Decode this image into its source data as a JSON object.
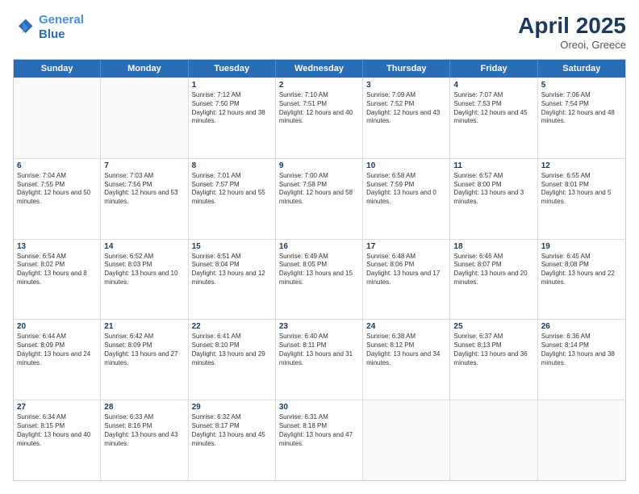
{
  "header": {
    "logo_line1": "General",
    "logo_line2": "Blue",
    "month_title": "April 2025",
    "location": "Oreoi, Greece"
  },
  "days_of_week": [
    "Sunday",
    "Monday",
    "Tuesday",
    "Wednesday",
    "Thursday",
    "Friday",
    "Saturday"
  ],
  "weeks": [
    [
      {
        "day": "",
        "empty": true
      },
      {
        "day": "",
        "empty": true
      },
      {
        "day": "1",
        "sunrise": "Sunrise: 7:12 AM",
        "sunset": "Sunset: 7:50 PM",
        "daylight": "Daylight: 12 hours and 38 minutes."
      },
      {
        "day": "2",
        "sunrise": "Sunrise: 7:10 AM",
        "sunset": "Sunset: 7:51 PM",
        "daylight": "Daylight: 12 hours and 40 minutes."
      },
      {
        "day": "3",
        "sunrise": "Sunrise: 7:09 AM",
        "sunset": "Sunset: 7:52 PM",
        "daylight": "Daylight: 12 hours and 43 minutes."
      },
      {
        "day": "4",
        "sunrise": "Sunrise: 7:07 AM",
        "sunset": "Sunset: 7:53 PM",
        "daylight": "Daylight: 12 hours and 45 minutes."
      },
      {
        "day": "5",
        "sunrise": "Sunrise: 7:06 AM",
        "sunset": "Sunset: 7:54 PM",
        "daylight": "Daylight: 12 hours and 48 minutes."
      }
    ],
    [
      {
        "day": "6",
        "sunrise": "Sunrise: 7:04 AM",
        "sunset": "Sunset: 7:55 PM",
        "daylight": "Daylight: 12 hours and 50 minutes."
      },
      {
        "day": "7",
        "sunrise": "Sunrise: 7:03 AM",
        "sunset": "Sunset: 7:56 PM",
        "daylight": "Daylight: 12 hours and 53 minutes."
      },
      {
        "day": "8",
        "sunrise": "Sunrise: 7:01 AM",
        "sunset": "Sunset: 7:57 PM",
        "daylight": "Daylight: 12 hours and 55 minutes."
      },
      {
        "day": "9",
        "sunrise": "Sunrise: 7:00 AM",
        "sunset": "Sunset: 7:58 PM",
        "daylight": "Daylight: 12 hours and 58 minutes."
      },
      {
        "day": "10",
        "sunrise": "Sunrise: 6:58 AM",
        "sunset": "Sunset: 7:59 PM",
        "daylight": "Daylight: 13 hours and 0 minutes."
      },
      {
        "day": "11",
        "sunrise": "Sunrise: 6:57 AM",
        "sunset": "Sunset: 8:00 PM",
        "daylight": "Daylight: 13 hours and 3 minutes."
      },
      {
        "day": "12",
        "sunrise": "Sunrise: 6:55 AM",
        "sunset": "Sunset: 8:01 PM",
        "daylight": "Daylight: 13 hours and 5 minutes."
      }
    ],
    [
      {
        "day": "13",
        "sunrise": "Sunrise: 6:54 AM",
        "sunset": "Sunset: 8:02 PM",
        "daylight": "Daylight: 13 hours and 8 minutes."
      },
      {
        "day": "14",
        "sunrise": "Sunrise: 6:52 AM",
        "sunset": "Sunset: 8:03 PM",
        "daylight": "Daylight: 13 hours and 10 minutes."
      },
      {
        "day": "15",
        "sunrise": "Sunrise: 6:51 AM",
        "sunset": "Sunset: 8:04 PM",
        "daylight": "Daylight: 13 hours and 12 minutes."
      },
      {
        "day": "16",
        "sunrise": "Sunrise: 6:49 AM",
        "sunset": "Sunset: 8:05 PM",
        "daylight": "Daylight: 13 hours and 15 minutes."
      },
      {
        "day": "17",
        "sunrise": "Sunrise: 6:48 AM",
        "sunset": "Sunset: 8:06 PM",
        "daylight": "Daylight: 13 hours and 17 minutes."
      },
      {
        "day": "18",
        "sunrise": "Sunrise: 6:46 AM",
        "sunset": "Sunset: 8:07 PM",
        "daylight": "Daylight: 13 hours and 20 minutes."
      },
      {
        "day": "19",
        "sunrise": "Sunrise: 6:45 AM",
        "sunset": "Sunset: 8:08 PM",
        "daylight": "Daylight: 13 hours and 22 minutes."
      }
    ],
    [
      {
        "day": "20",
        "sunrise": "Sunrise: 6:44 AM",
        "sunset": "Sunset: 8:09 PM",
        "daylight": "Daylight: 13 hours and 24 minutes."
      },
      {
        "day": "21",
        "sunrise": "Sunrise: 6:42 AM",
        "sunset": "Sunset: 8:09 PM",
        "daylight": "Daylight: 13 hours and 27 minutes."
      },
      {
        "day": "22",
        "sunrise": "Sunrise: 6:41 AM",
        "sunset": "Sunset: 8:10 PM",
        "daylight": "Daylight: 13 hours and 29 minutes."
      },
      {
        "day": "23",
        "sunrise": "Sunrise: 6:40 AM",
        "sunset": "Sunset: 8:11 PM",
        "daylight": "Daylight: 13 hours and 31 minutes."
      },
      {
        "day": "24",
        "sunrise": "Sunrise: 6:38 AM",
        "sunset": "Sunset: 8:12 PM",
        "daylight": "Daylight: 13 hours and 34 minutes."
      },
      {
        "day": "25",
        "sunrise": "Sunrise: 6:37 AM",
        "sunset": "Sunset: 8:13 PM",
        "daylight": "Daylight: 13 hours and 36 minutes."
      },
      {
        "day": "26",
        "sunrise": "Sunrise: 6:36 AM",
        "sunset": "Sunset: 8:14 PM",
        "daylight": "Daylight: 13 hours and 38 minutes."
      }
    ],
    [
      {
        "day": "27",
        "sunrise": "Sunrise: 6:34 AM",
        "sunset": "Sunset: 8:15 PM",
        "daylight": "Daylight: 13 hours and 40 minutes."
      },
      {
        "day": "28",
        "sunrise": "Sunrise: 6:33 AM",
        "sunset": "Sunset: 8:16 PM",
        "daylight": "Daylight: 13 hours and 43 minutes."
      },
      {
        "day": "29",
        "sunrise": "Sunrise: 6:32 AM",
        "sunset": "Sunset: 8:17 PM",
        "daylight": "Daylight: 13 hours and 45 minutes."
      },
      {
        "day": "30",
        "sunrise": "Sunrise: 6:31 AM",
        "sunset": "Sunset: 8:18 PM",
        "daylight": "Daylight: 13 hours and 47 minutes."
      },
      {
        "day": "",
        "empty": true
      },
      {
        "day": "",
        "empty": true
      },
      {
        "day": "",
        "empty": true
      }
    ]
  ]
}
